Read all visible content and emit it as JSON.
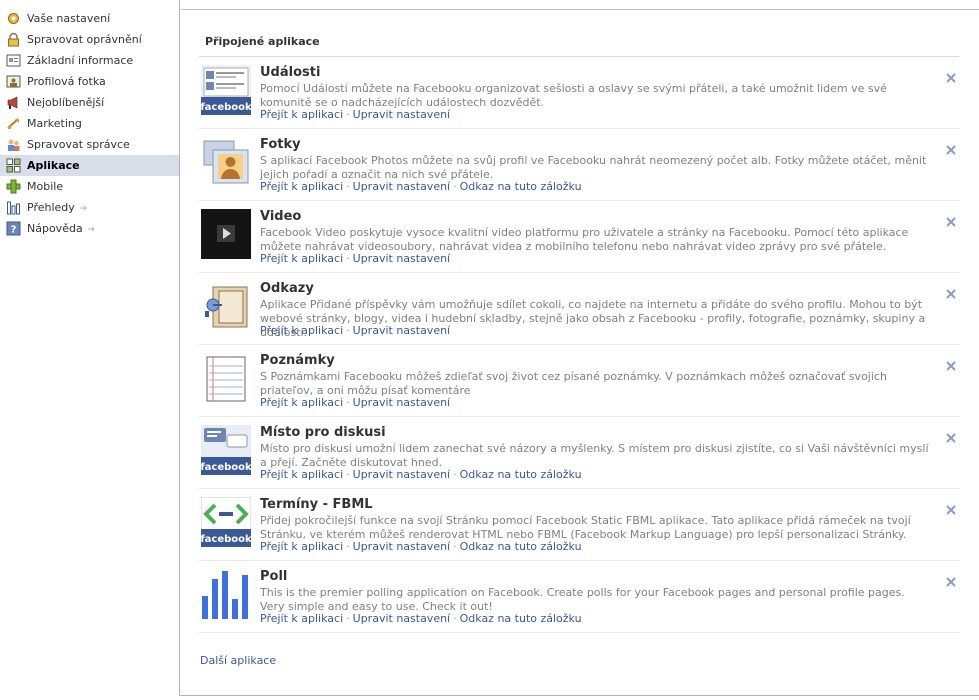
{
  "sidebar": {
    "items": [
      {
        "label": "Vaše nastavení",
        "icon": "gear-icon"
      },
      {
        "label": "Spravovat oprávnění",
        "icon": "lock-icon"
      },
      {
        "label": "Základní informace",
        "icon": "info-card-icon"
      },
      {
        "label": "Profilová fotka",
        "icon": "photo-icon"
      },
      {
        "label": "Nejoblíbenější",
        "icon": "megaphone-icon"
      },
      {
        "label": "Marketing",
        "icon": "marketing-icon"
      },
      {
        "label": "Spravovat správce",
        "icon": "admins-icon"
      },
      {
        "label": "Aplikace",
        "icon": "apps-icon"
      },
      {
        "label": "Mobile",
        "icon": "mobile-icon"
      },
      {
        "label": "Přehledy",
        "icon": "insights-icon",
        "arrow": "➔"
      },
      {
        "label": "Nápověda",
        "icon": "help-icon",
        "arrow": "➔"
      }
    ],
    "active_index": 7
  },
  "main": {
    "section_title": "Připojené aplikace",
    "links": {
      "goto": "Přejít k aplikaci",
      "edit": "Upravit nastavení",
      "tab": "Odkaz na tuto záložku",
      "separator": "·"
    },
    "apps": [
      {
        "name": "Události",
        "icon": "events-icon",
        "description": "Pomocí Událostí můžete na Facebooku organizovat sešlosti a oslavy se svými přáteli, a také umožnit lidem ve své komunitě se o nadcházejících událostech dozvědět.",
        "show_tab_link": false,
        "brand": "facebook"
      },
      {
        "name": "Fotky",
        "icon": "photos-icon",
        "description": "S aplikací Facebook Photos můžete na svůj profil ve Facebooku nahrát neomezený počet alb. Fotky můžete otáčet, měnit jejich pořadí a označit na nich své přátele.",
        "show_tab_link": true
      },
      {
        "name": "Video",
        "icon": "video-icon",
        "description": "Facebook Video poskytuje vysoce kvalitní video platformu pro uživatele a stránky na Facebooku. Pomocí této aplikace můžete nahrávat videosoubory, nahrávat videa z mobilního telefonu nebo nahrávat video zprávy pro své přátele.",
        "show_tab_link": false
      },
      {
        "name": "Odkazy",
        "icon": "links-icon",
        "description": "Aplikace Přidané příspěvky vám umožňuje sdílet cokoli, co najdete na internetu a přidáte do svého profilu. Mohou to být webové stránky, blogy, videa i hudební skladby, stejně jako obsah z Facebooku - profily, fotografie, poznámky, skupiny a události.",
        "show_tab_link": false
      },
      {
        "name": "Poznámky",
        "icon": "notes-icon",
        "description": "S Poznámkami Facebooku môžeš zdieľať svoj život cez písané poznámky. V poznámkach môžeš označovať svojich priateľov, a oni môžu písať komentáre",
        "show_tab_link": false
      },
      {
        "name": "Místo pro diskusi",
        "icon": "discussion-icon",
        "description": "Místo pro diskusi umožní lidem zanechat své názory a myšlenky. S místem pro diskusi zjistíte, co si Vaši návštěvníci myslí a přejí. Začněte diskutovat hned.",
        "show_tab_link": true,
        "brand": "facebook"
      },
      {
        "name": "Termíny - FBML",
        "icon": "fbml-icon",
        "description": "Přidej pokročilejší funkce na svojí Stránku pomocí Facebook Static FBML aplikace. Tato aplikace přidá rámeček na tvojí Stránku, ve kterém můžeš renderovat HTML nebo FBML (Facebook Markup Language) pro lepší personalizaci Stránky.",
        "show_tab_link": true,
        "brand": "facebook"
      },
      {
        "name": "Poll",
        "icon": "poll-icon",
        "description": "This is the premier polling application on Facebook. Create polls for your Facebook pages and personal profile pages. Very simple and easy to use. Check it out!",
        "show_tab_link": true
      }
    ],
    "more_apps": "Další aplikace"
  },
  "colors": {
    "link": "#3b5998",
    "active_nav_bg": "#d8dfea",
    "muted_text": "#808080"
  }
}
